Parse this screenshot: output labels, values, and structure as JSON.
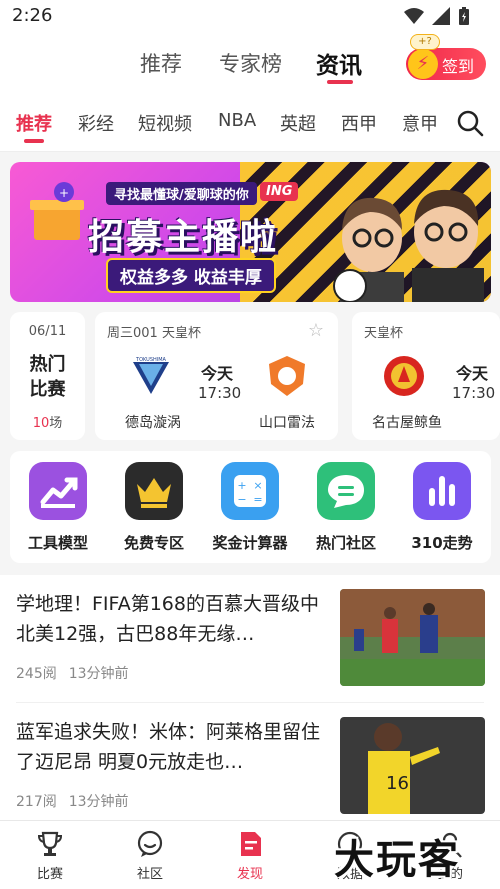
{
  "status_bar": {
    "time": "2:26"
  },
  "top_tabs": {
    "items": [
      "推荐",
      "专家榜",
      "资讯"
    ],
    "active": "资讯",
    "sign_in_label": "签到",
    "sign_in_badge": "+?"
  },
  "category_tabs": {
    "items": [
      "推荐",
      "彩经",
      "短视频",
      "NBA",
      "英超",
      "西甲",
      "意甲"
    ],
    "active": "推荐"
  },
  "banner": {
    "subtitle": "寻找最懂球/爱聊球的你",
    "badge": "ING",
    "title": "招募主播啦",
    "tagline": "权益多多 收益丰厚"
  },
  "matches": {
    "day_card": {
      "date": "06/11",
      "title_line1": "热门",
      "title_line2": "比赛",
      "count": "10",
      "count_unit": "场"
    },
    "cards": [
      {
        "league": "周三001 天皇杯",
        "home": "德岛漩涡",
        "away": "山口雷法",
        "day": "今天",
        "time": "17:30"
      },
      {
        "league": "天皇杯",
        "home": "名古屋鲸鱼",
        "day": "今天",
        "time": "17:30"
      }
    ]
  },
  "shortcuts": [
    {
      "label": "工具模型",
      "icon": "chart-trend-icon",
      "color": "#9b51e0"
    },
    {
      "label": "免费专区",
      "icon": "crown-icon",
      "color": "#2b2b2b"
    },
    {
      "label": "奖金计算器",
      "icon": "calculator-icon",
      "color": "#3aa0f0"
    },
    {
      "label": "热门社区",
      "icon": "chat-bubble-icon",
      "color": "#2ec07a"
    },
    {
      "label": "310走势",
      "icon": "bar-chart-icon",
      "color": "#7b56f0"
    }
  ],
  "news": [
    {
      "title": "学地理！FIFA第168的百慕大晋级中北美12强，古巴88年无缘…",
      "reads": "245阅",
      "time": "13分钟前"
    },
    {
      "title": "蓝军追求失败！米体：阿莱格里留住了迈尼昂 明夏0元放走也…",
      "reads": "217阅",
      "time": "13分钟前"
    }
  ],
  "bottom_nav": [
    {
      "label": "比赛",
      "icon": "trophy-icon"
    },
    {
      "label": "社区",
      "icon": "chat-icon"
    },
    {
      "label": "发现",
      "icon": "discover-icon",
      "active": true
    },
    {
      "label": "数据",
      "icon": "data-icon"
    },
    {
      "label": "我的",
      "icon": "profile-icon"
    }
  ],
  "watermark": "大玩客",
  "colors": {
    "accent": "#e8324f"
  }
}
